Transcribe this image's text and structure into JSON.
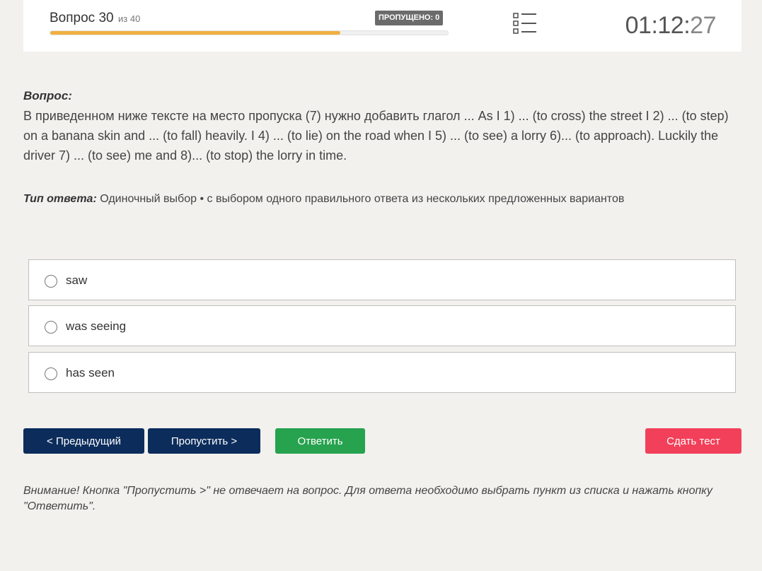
{
  "header": {
    "question_label": "Вопрос 30",
    "question_of": "из 40",
    "progress": 0.73,
    "skipped_badge": "ПРОПУЩЕНО: 0",
    "timer_hm": "01:12",
    "timer_sep": ":",
    "timer_sec": "27",
    "list_icon": "list-icon"
  },
  "question": {
    "heading": "Вопрос:",
    "text": "В приведенном ниже тексте на место пропуска (7) нужно добавить глагол ... As I 1) ... (to cross) the street I 2) ... (to step) on a banana skin and ... (to fall) heavily. I 4) ... (to lie) on the road when I 5) ... (to see) a lorry 6)... (to approach). Luckily the driver 7) ... (to see) me and 8)... (to stop) the lorry in time."
  },
  "answer_type": {
    "label": "Тип ответа:",
    "value": "Одиночный выбор • с выбором одного правильного ответа из нескольких предложенных вариантов"
  },
  "options": [
    {
      "label": "saw"
    },
    {
      "label": "was seeing"
    },
    {
      "label": "has seen"
    }
  ],
  "buttons": {
    "prev": "< Предыдущий",
    "skip": "Пропустить >",
    "answer": "Ответить",
    "finish": "Сдать тест"
  },
  "notice": "Внимание! Кнопка \"Пропустить >\" не отвечает на вопрос. Для ответа необходимо выбрать пункт из списка и нажать кнопку \"Ответить\".",
  "colors": {
    "progress_fill": "#f0b040",
    "nav_button": "#0c2d5c",
    "answer_button": "#27a24f",
    "finish_button": "#f2405a"
  }
}
